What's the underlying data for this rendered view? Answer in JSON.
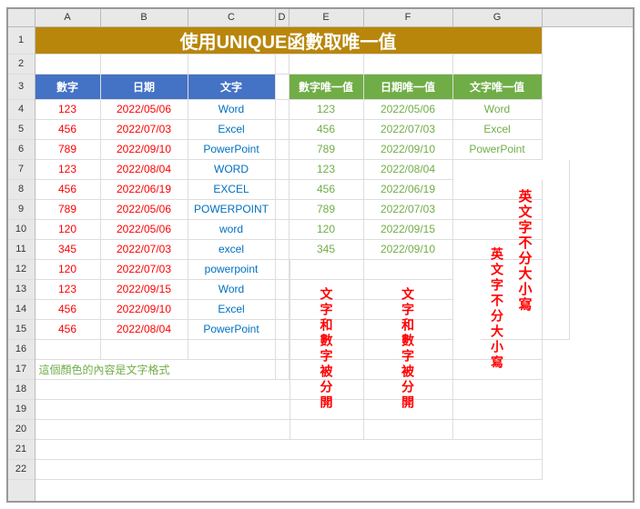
{
  "title": "使用UNIQUE函數取唯一值",
  "colHeaders": [
    "A",
    "B",
    "C",
    "D",
    "E",
    "F",
    "G"
  ],
  "rowHeaders": [
    "1",
    "2",
    "3",
    "4",
    "5",
    "6",
    "7",
    "8",
    "9",
    "10",
    "11",
    "12",
    "13",
    "14",
    "15",
    "16",
    "17",
    "18",
    "19",
    "20",
    "21",
    "22"
  ],
  "headers": {
    "num": "數字",
    "date": "日期",
    "text": "文字",
    "unum": "數字唯一值",
    "udate": "日期唯一值",
    "utext": "文字唯一值"
  },
  "data": [
    {
      "num": "123",
      "date": "2022/05/06",
      "text": "Word",
      "unum": "123",
      "udate": "2022/05/06",
      "utext": "Word"
    },
    {
      "num": "456",
      "date": "2022/07/03",
      "text": "Excel",
      "unum": "456",
      "udate": "2022/07/03",
      "utext": "Excel"
    },
    {
      "num": "789",
      "date": "2022/09/10",
      "text": "PowerPoint",
      "unum": "789",
      "udate": "2022/09/10",
      "utext": "PowerPoint"
    },
    {
      "num": "123",
      "date": "2022/08/04",
      "text": "WORD",
      "unum": "123",
      "udate": "2022/08/04",
      "utext": ""
    },
    {
      "num": "456",
      "date": "2022/06/19",
      "text": "EXCEL",
      "unum": "456",
      "udate": "2022/06/19",
      "utext": ""
    },
    {
      "num": "789",
      "date": "2022/05/06",
      "text": "POWERPOINT",
      "unum": "789",
      "udate": "2022/07/03",
      "utext": ""
    },
    {
      "num": "120",
      "date": "2022/05/06",
      "text": "word",
      "unum": "120",
      "udate": "2022/09/15",
      "utext": ""
    },
    {
      "num": "345",
      "date": "2022/07/03",
      "text": "excel",
      "unum": "345",
      "udate": "2022/09/10",
      "utext": ""
    },
    {
      "num": "120",
      "date": "2022/07/03",
      "text": "powerpoint",
      "unum": "",
      "udate": "",
      "utext": ""
    },
    {
      "num": "123",
      "date": "2022/09/15",
      "text": "Word",
      "unum": "",
      "udate": "",
      "utext": ""
    },
    {
      "num": "456",
      "date": "2022/09/10",
      "text": "Excel",
      "unum": "",
      "udate": "",
      "utext": ""
    },
    {
      "num": "456",
      "date": "2022/08/04",
      "text": "PowerPoint",
      "unum": "",
      "udate": "",
      "utext": ""
    }
  ],
  "mergedTexts": {
    "col1": "文字和數字被分開",
    "col2": "文字和數字被分開",
    "col3": "英文字不分大小寫"
  },
  "note": "這個顏色的內容是文字格式",
  "colors": {
    "titleBg": "#b8860b",
    "titleText": "#ffffff",
    "headerBg1": "#4472c4",
    "headerBg2": "#70ad47",
    "red": "#ff0000",
    "blue": "#0070c0",
    "green": "#70ad47"
  }
}
